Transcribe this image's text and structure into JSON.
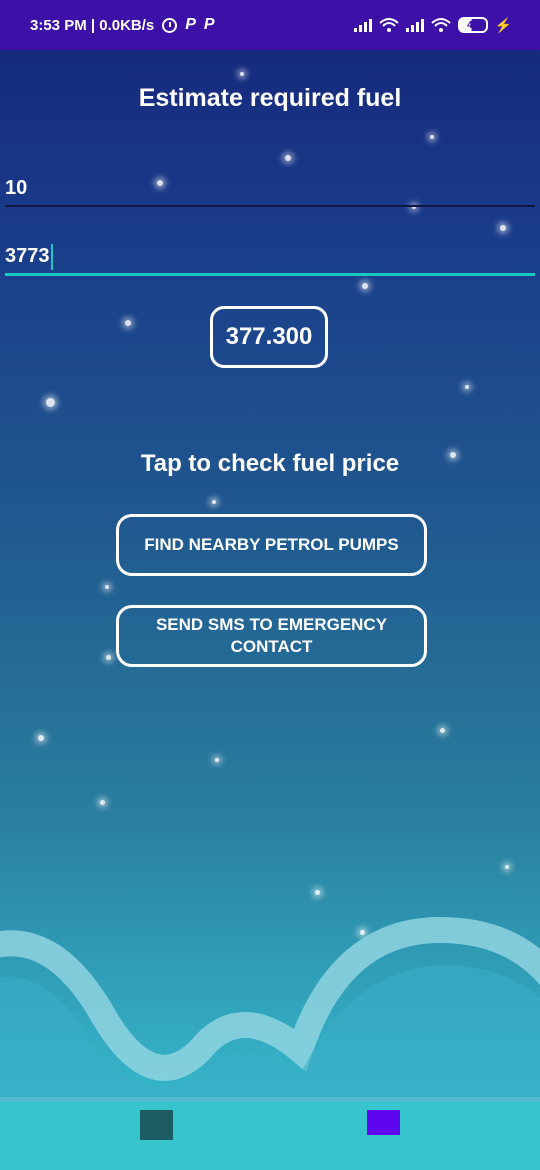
{
  "status_bar": {
    "time_info": "3:53 PM | 0.0KB/s",
    "p_label_1": "P",
    "p_label_2": "P",
    "battery": "44",
    "background": "#3d11a8"
  },
  "main": {
    "title": "Estimate required fuel",
    "input_1_value": "10",
    "input_2_value": "3773",
    "result_value": "377.300",
    "tap_text": "Tap to check fuel price",
    "buttons": {
      "find_pumps": "FIND NEARBY PETROL PUMPS",
      "send_sms": "SEND SMS TO EMERGENCY CONTACT"
    }
  },
  "colors": {
    "accent_underline": "#19c9c0",
    "bottom_bar": "#38c4cc",
    "square_teal": "#1d5c63",
    "square_purple": "#5e06ee"
  },
  "icons": [
    "alarm-icon",
    "signal-icon",
    "wifi-icon",
    "battery-icon",
    "charging-bolt-icon"
  ]
}
